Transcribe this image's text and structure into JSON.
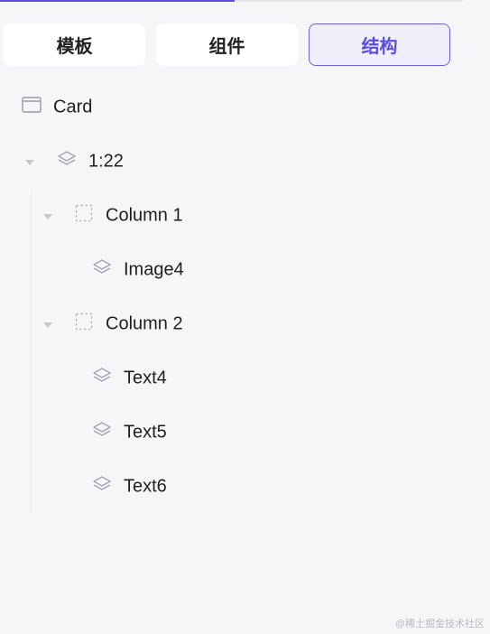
{
  "tabs": [
    {
      "label": "模板",
      "active": false
    },
    {
      "label": "组件",
      "active": false
    },
    {
      "label": "结构",
      "active": true
    }
  ],
  "tree": {
    "root": {
      "label": "Card",
      "icon": "card-icon"
    },
    "group": {
      "label": "1:22",
      "icon": "layers-icon",
      "expanded": true
    },
    "column1": {
      "label": "Column 1",
      "icon": "dashed-box-icon",
      "expanded": true
    },
    "image4": {
      "label": "Image4",
      "icon": "layers-icon"
    },
    "column2": {
      "label": "Column 2",
      "icon": "dashed-box-icon",
      "expanded": true
    },
    "text4": {
      "label": "Text4",
      "icon": "layers-icon"
    },
    "text5": {
      "label": "Text5",
      "icon": "layers-icon"
    },
    "text6": {
      "label": "Text6",
      "icon": "layers-icon"
    }
  },
  "watermark": "@稀土掘金技术社区",
  "colors": {
    "accent": "#5b4de0",
    "background": "#f6f6f9"
  }
}
